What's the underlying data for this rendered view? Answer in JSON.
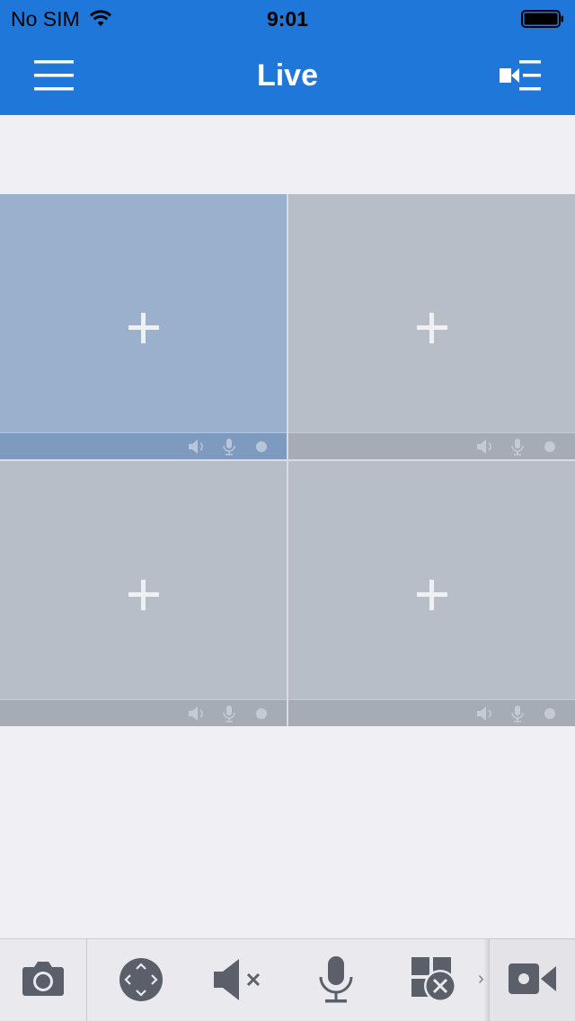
{
  "status_bar": {
    "carrier": "No SIM",
    "time": "9:01"
  },
  "nav": {
    "title": "Live",
    "left_icon": "hamburger-menu-icon",
    "right_icon": "camera-list-icon"
  },
  "grid": {
    "cells": [
      {
        "icon": "plus-icon",
        "active": true
      },
      {
        "icon": "plus-icon",
        "active": false
      },
      {
        "icon": "plus-icon",
        "active": false
      },
      {
        "icon": "plus-icon",
        "active": false
      }
    ],
    "cell_icons": [
      "speaker-icon",
      "microphone-icon",
      "record-dot-icon"
    ]
  },
  "toolbar": {
    "items": [
      "camera-snapshot-icon",
      "ptz-control-icon",
      "mute-icon",
      "microphone-icon",
      "close-all-icon",
      "record-video-icon"
    ],
    "more": "›"
  },
  "colors": {
    "nav_blue": "#1f78d9",
    "cell_gray": "#b8bec8",
    "cell_active": "#9ab0cd",
    "icon_dark": "#5a5f6a"
  }
}
